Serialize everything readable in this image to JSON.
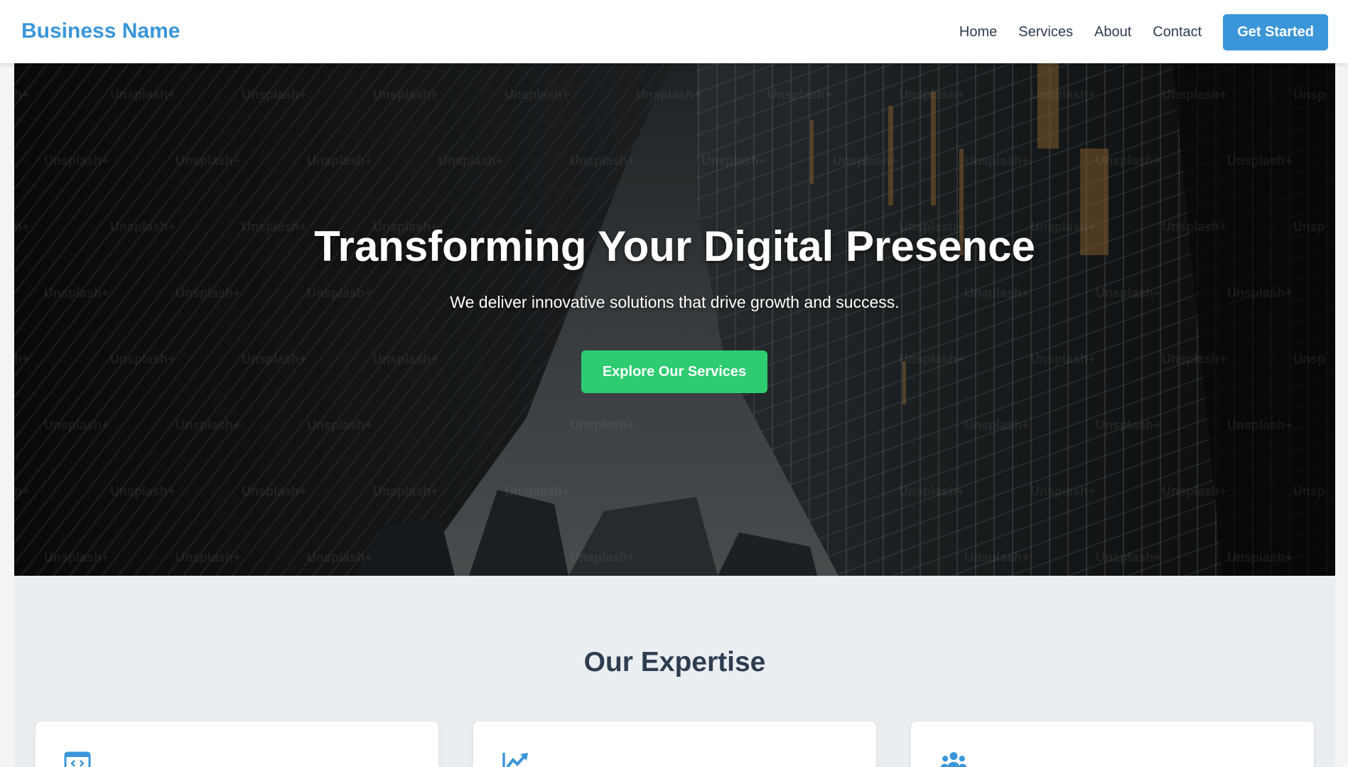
{
  "header": {
    "logo": "Business Name",
    "nav": [
      "Home",
      "Services",
      "About",
      "Contact"
    ],
    "cta_label": "Get Started"
  },
  "hero": {
    "title": "Transforming Your Digital Presence",
    "subtitle": "We deliver innovative solutions that drive growth and success.",
    "cta_label": "Explore Our Services",
    "background": "skyscrapers-upward-view-photo",
    "watermark": "Unsplash+"
  },
  "expertise": {
    "title": "Our Expertise",
    "cards": [
      {
        "icon": "code-window-icon"
      },
      {
        "icon": "trending-up-icon"
      },
      {
        "icon": "users-icon"
      }
    ]
  },
  "colors": {
    "brand": "#3a96d8",
    "accent_green": "#2ecc71",
    "heading": "#2e3d4f",
    "section_bg": "#ebeef1"
  }
}
